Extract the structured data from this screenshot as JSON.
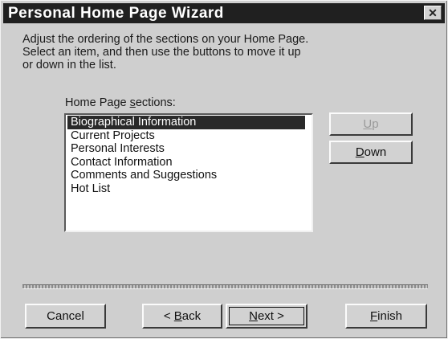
{
  "window": {
    "title": "Personal Home Page Wizard",
    "close_symbol": "✕"
  },
  "instructions": [
    "Adjust the ordering of the sections on your Home Page.",
    "Select an item, and then use the buttons to move it up",
    "or down in the list."
  ],
  "list": {
    "label_pre": "Home Page ",
    "label_accel": "s",
    "label_post": "ections:",
    "items": [
      "Biographical Information",
      "Current Projects",
      "Personal Interests",
      "Contact Information",
      "Comments and Suggestions",
      "Hot List"
    ],
    "selected_index": 0
  },
  "buttons": {
    "up": {
      "accel": "U",
      "rest": "p",
      "enabled": false
    },
    "down": {
      "accel": "D",
      "rest": "own",
      "enabled": true
    },
    "cancel": {
      "label": "Cancel"
    },
    "back": {
      "prefix": "< ",
      "accel": "B",
      "rest": "ack"
    },
    "next": {
      "accel": "N",
      "rest": "ext >"
    },
    "finish": {
      "accel": "F",
      "rest": "inish"
    }
  },
  "icons": {
    "close": "close-icon"
  }
}
